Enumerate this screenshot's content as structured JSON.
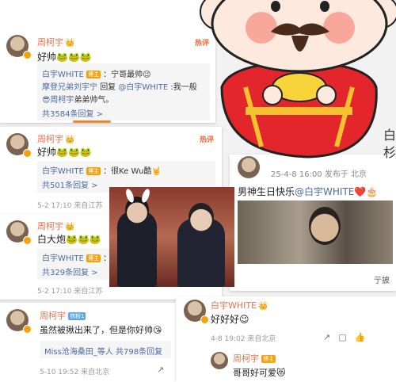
{
  "card1": {
    "username": "周柯宇",
    "hot": "热评",
    "text": "好帅🐸🐸🐸",
    "replies": [
      {
        "user": "白宇WHITE",
        "tag": "博主",
        "content": "：宁哥最帅😉"
      },
      {
        "user": "摩登兄弟刘宇宁",
        "mid": "回复",
        "user2": "@白宇WHITE",
        "content": ":我一般"
      },
      {
        "user": "😎周柯宇",
        "content": "弟弟帅气。"
      }
    ],
    "more": "共3584条回复 >"
  },
  "card2": {
    "username": "周柯宇",
    "hot": "热评",
    "text": "好帅🐸🐸🐸",
    "reply_user": "白宇WHITE",
    "reply_tag": "博主",
    "reply_text": "：很Ke Wu酷🤘",
    "more": "共501条回复 >",
    "meta": "5-2 17:10 来自江苏"
  },
  "card3": {
    "username": "周柯宇",
    "text": "白大炮🐸🐸🐸",
    "reply_user": "白宇WHITE",
    "reply_tag": "博主",
    "reply_text": "：棒",
    "more": "共329条回复 >",
    "meta": "5-2 17:10 来自江苏"
  },
  "card4": {
    "username": "周柯宇",
    "badge": "铁粉1",
    "text": "虽然被揪出来了，但是你好帅😘",
    "reply_text": "Miss沧海桑田_等人  共798条回复",
    "meta": "5-10 19:52 来自北京"
  },
  "post": {
    "meta_date": "25-4-8 16:00",
    "meta_source": "发布于 北京",
    "text": "男神生日快乐",
    "mention": "@白宇WHITE",
    "emoji": "❤️🎂",
    "right_edge_text": "白\n杉",
    "forward": "亍披"
  },
  "card5": {
    "username": "白宇WHITE",
    "text": "好好好😉",
    "meta": "4-8 19:02 来自北京",
    "reply_user": "周柯宇",
    "reply_badge": "博主",
    "reply_text": "哥哥好可爱😻"
  },
  "colors": {
    "accent": "#f06a39",
    "link": "#4f6ba1",
    "bg": "#f2f2f2"
  }
}
